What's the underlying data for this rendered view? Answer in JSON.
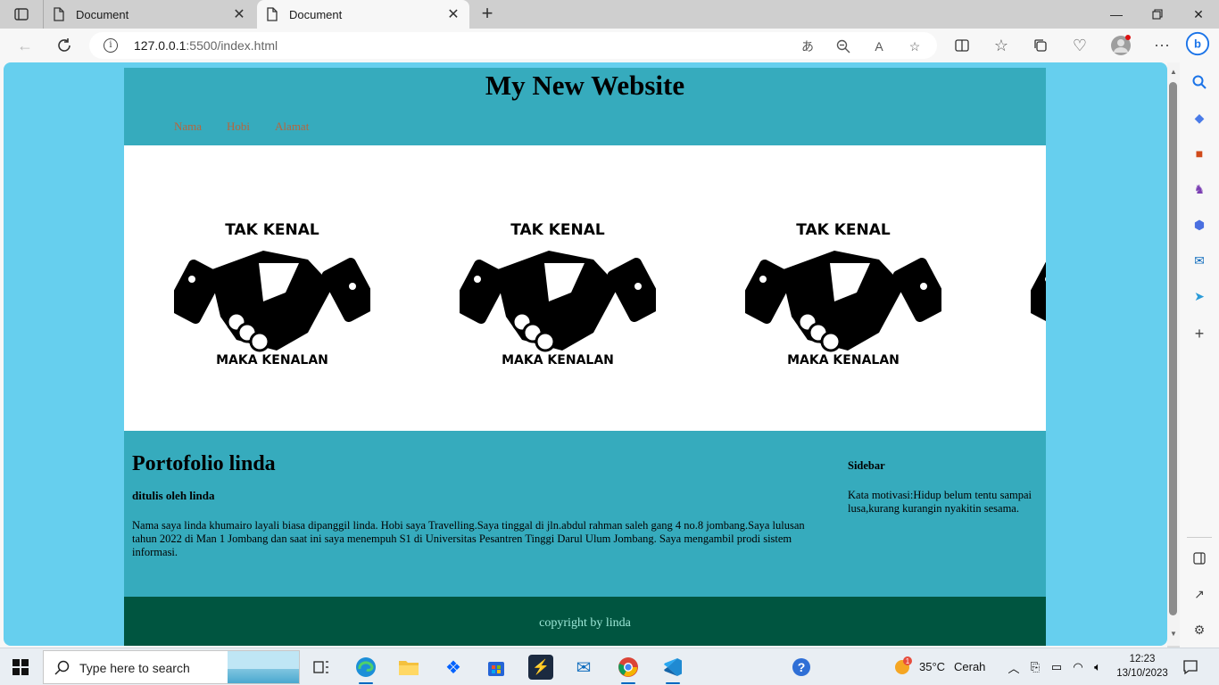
{
  "browser": {
    "tabs": [
      {
        "title": "Document",
        "active": false
      },
      {
        "title": "Document",
        "active": true
      }
    ],
    "url_host": "127.0.0.1",
    "url_rest": ":5500/index.html"
  },
  "site": {
    "title": "My New Website",
    "nav": [
      "Nama",
      "Hobi",
      "Alamat"
    ],
    "hero": {
      "top_text": "TAK KENAL",
      "bottom_text": "MAKA KENALAN"
    },
    "article": {
      "heading": "Portofolio linda",
      "byline": "ditulis oleh linda",
      "body": "Nama saya linda khumairo layali biasa dipanggil linda. Hobi saya Travelling.Saya tinggal di jln.abdul rahman saleh gang 4 no.8 jombang.Saya lulusan tahun 2022 di Man 1 Jombang dan saat ini saya menempuh S1 di Universitas Pesantren Tinggi Darul Ulum Jombang. Saya mengambil prodi sistem informasi."
    },
    "sidebar": {
      "heading": "Sidebar",
      "text": "Kata motivasi:Hidup belum tentu sampai lusa,kurang kurangin nyakitin sesama."
    },
    "footer": "copyright by linda",
    "colors": {
      "page_bg": "#66cfee",
      "header_bg": "#36abbd",
      "footer_bg": "#005540",
      "nav_link": "#b7653d"
    }
  },
  "taskbar": {
    "search_placeholder": "Type here to search",
    "weather_temp": "35°C",
    "weather_desc": "Cerah",
    "weather_badge": "1",
    "time": "12:23",
    "date": "13/10/2023"
  }
}
